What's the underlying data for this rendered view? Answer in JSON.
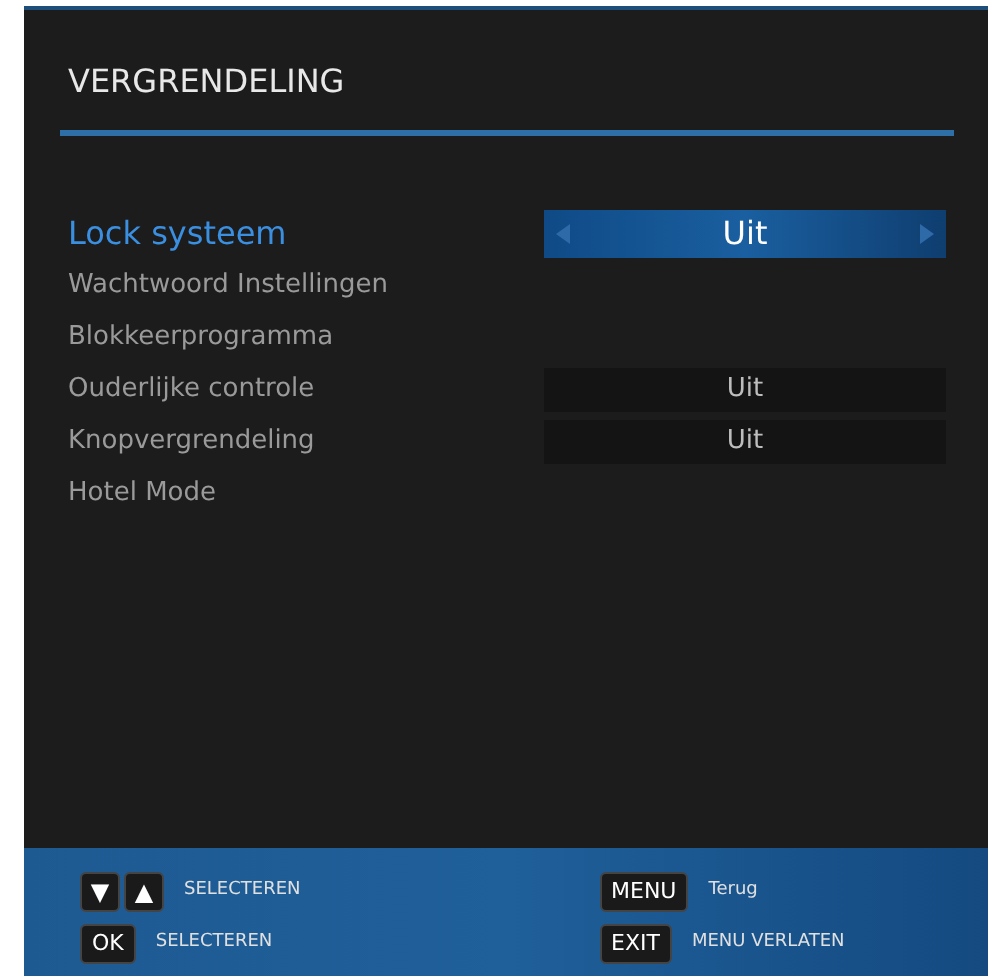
{
  "title": "VERGRENDELING",
  "items": [
    {
      "label": "Lock systeem",
      "selected": true,
      "kind": "selector",
      "value": "Uit"
    },
    {
      "label": "Wachtwoord Instellingen",
      "selected": false,
      "kind": "plain"
    },
    {
      "label": "Blokkeerprogramma",
      "selected": false,
      "kind": "plain"
    },
    {
      "label": "Ouderlijke controle",
      "selected": false,
      "kind": "value",
      "value": "Uit"
    },
    {
      "label": "Knopvergrendeling",
      "selected": false,
      "kind": "value",
      "value": "Uit"
    },
    {
      "label": "Hotel Mode",
      "selected": false,
      "kind": "plain"
    }
  ],
  "footer": [
    {
      "keys": [
        "▼",
        "▲"
      ],
      "label": "SELECTEREN"
    },
    {
      "keys": [
        "MENU"
      ],
      "label": "Terug"
    },
    {
      "keys": [
        "OK"
      ],
      "label": "SELECTEREN"
    },
    {
      "keys": [
        "EXIT"
      ],
      "label": "MENU VERLATEN"
    }
  ]
}
